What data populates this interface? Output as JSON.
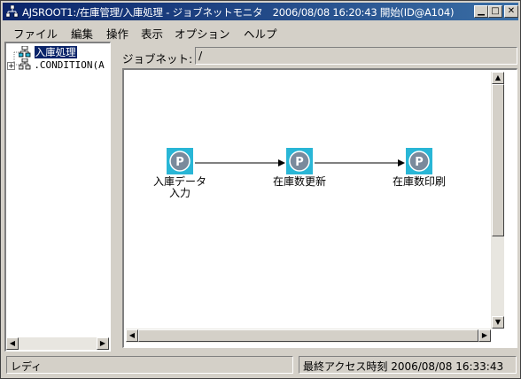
{
  "window": {
    "title": "AJSROOT1:/在庫管理/入庫処理 - ジョブネットモニタ　2006/08/08 16:20:43 開始(ID@A104)"
  },
  "menu": {
    "items": [
      "ファイル",
      "編集",
      "操作",
      "表示",
      "オプション",
      "ヘルプ"
    ]
  },
  "tree": {
    "items": [
      {
        "label": "入庫処理",
        "icon": "jobnet-icon"
      },
      {
        "label": ".CONDITION(A",
        "icon": "condition-icon"
      }
    ]
  },
  "jobnet": {
    "label": "ジョブネット:",
    "value": "/"
  },
  "nodes": [
    {
      "label": "入庫データ\n入力"
    },
    {
      "label": "在庫数更新"
    },
    {
      "label": "在庫数印刷"
    }
  ],
  "status": {
    "left": "レディ",
    "right": "最終アクセス時刻 2006/08/08 16:33:43"
  },
  "colors": {
    "title_bar": "#0a246a",
    "node_icon": "#29b6d6",
    "selection": "#0a246a"
  }
}
